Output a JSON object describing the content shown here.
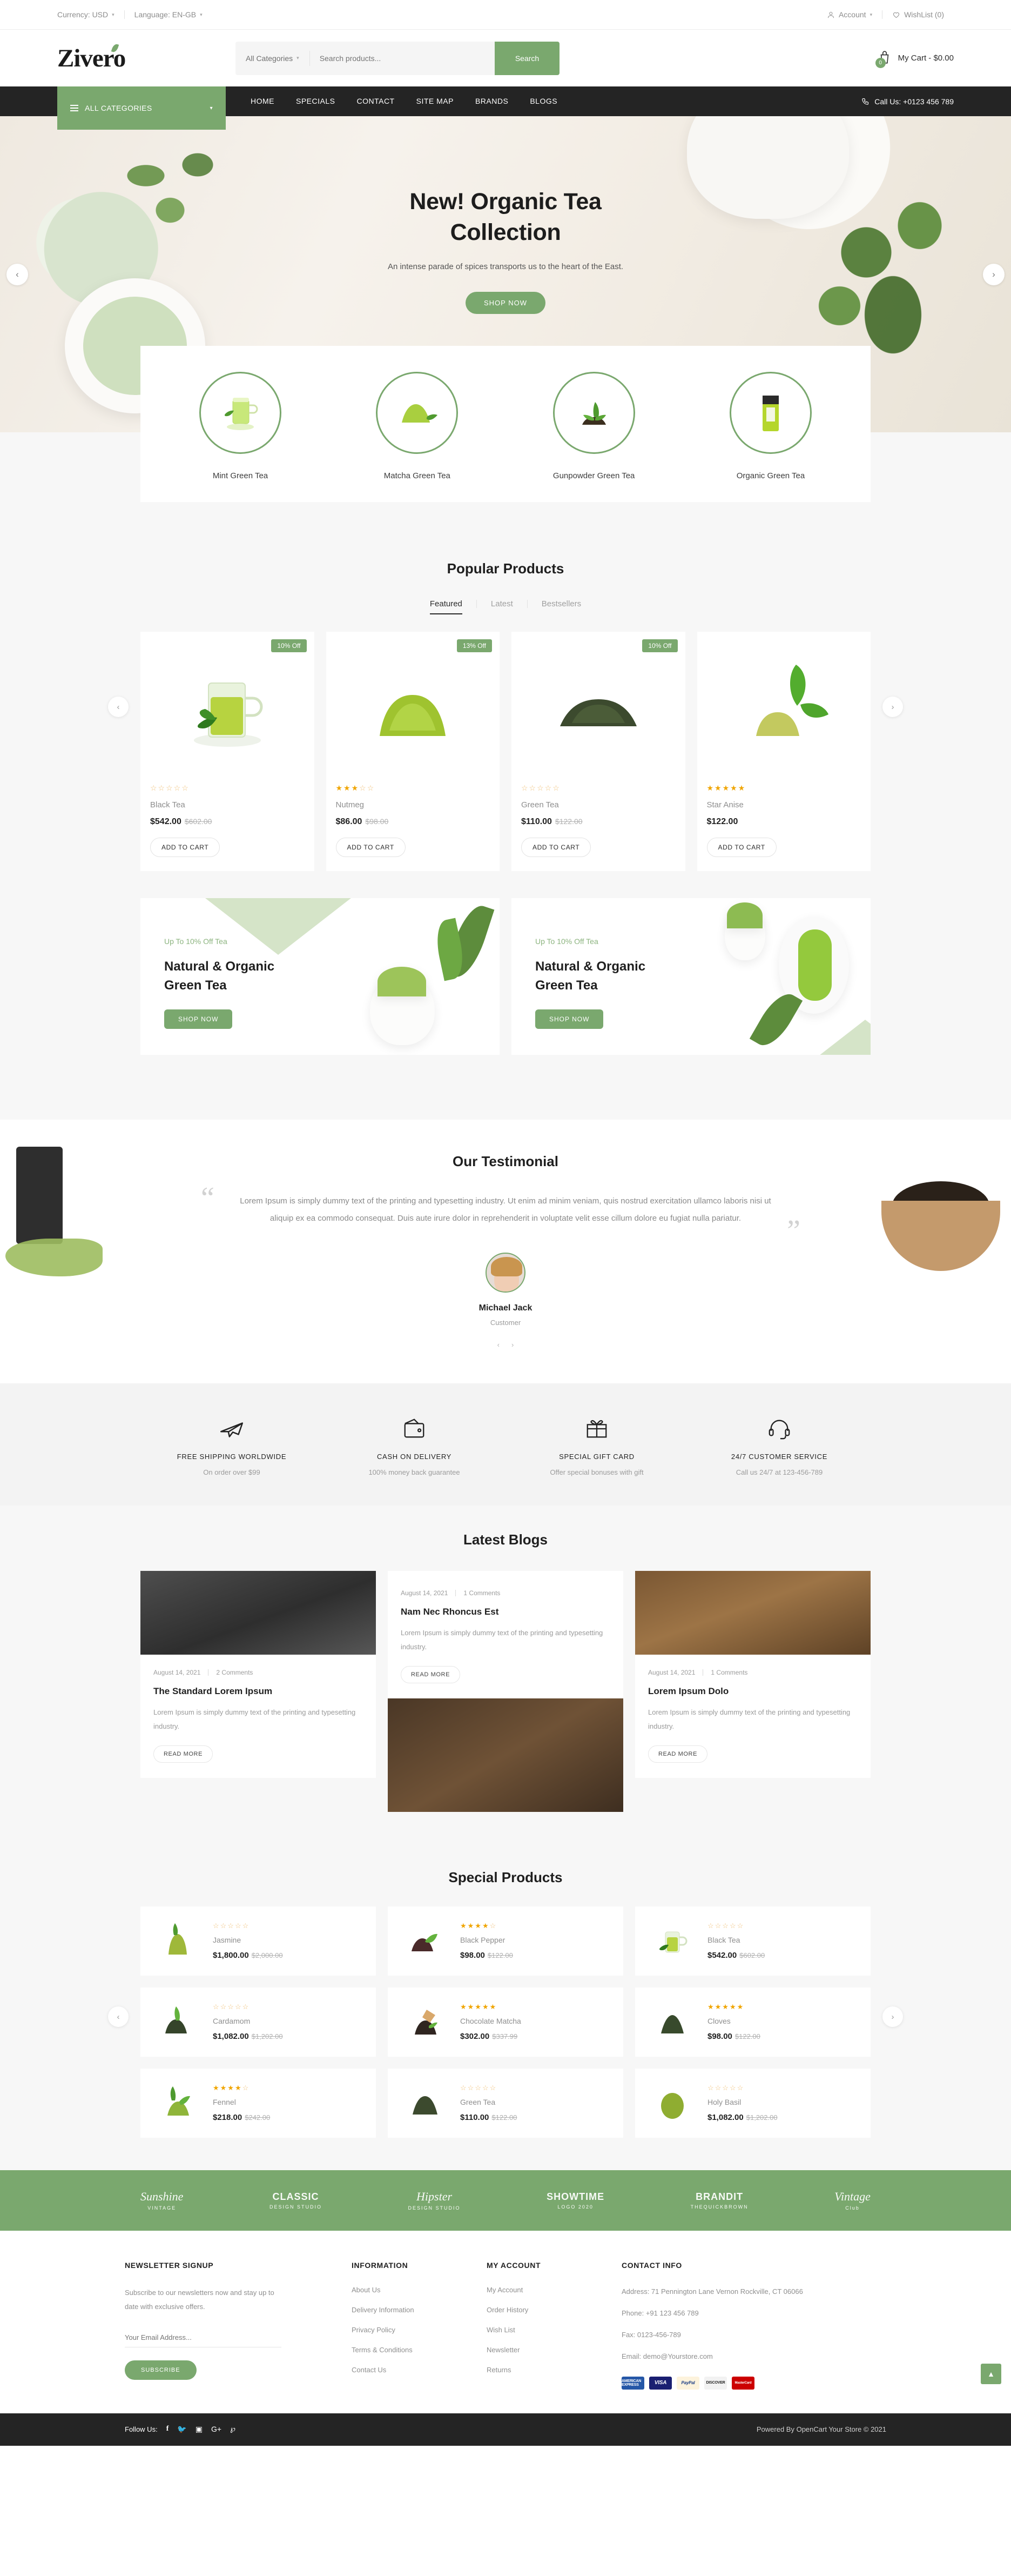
{
  "topbar": {
    "currency_label": "Currency: USD",
    "language_label": "Language: EN-GB",
    "account_label": "Account",
    "wishlist_label": "WishList (0)"
  },
  "header": {
    "logo": "Zivero",
    "category_select": "All Categories",
    "search_placeholder": "Search products...",
    "search_button": "Search",
    "cart_label": "My Cart - $0.00",
    "cart_count": "0"
  },
  "nav": {
    "all_categories": "ALL CATEGORIES",
    "links": [
      "HOME",
      "SPECIALS",
      "CONTACT",
      "SITE MAP",
      "BRANDS",
      "BLOGS"
    ],
    "call_us": "Call Us: +0123 456 789"
  },
  "hero": {
    "title_line1": "New! Organic Tea",
    "title_line2": "Collection",
    "subtitle": "An intense parade of spices transports us to the heart of the East.",
    "cta": "SHOP NOW",
    "prev": "‹",
    "next": "›"
  },
  "categories": [
    {
      "name": "Mint Green Tea"
    },
    {
      "name": "Matcha Green Tea"
    },
    {
      "name": "Gunpowder Green Tea"
    },
    {
      "name": "Organic Green Tea"
    }
  ],
  "popular": {
    "title": "Popular Products",
    "tabs": [
      {
        "label": "Featured",
        "active": true
      },
      {
        "label": "Latest",
        "active": false
      },
      {
        "label": "Bestsellers",
        "active": false
      }
    ],
    "add_to_cart": "ADD TO CART",
    "prev": "‹",
    "next": "›",
    "products": [
      {
        "name": "Black Tea",
        "price": "$542.00",
        "old_price": "$602.00",
        "badge": "10% Off",
        "stars": 0
      },
      {
        "name": "Nutmeg",
        "price": "$86.00",
        "old_price": "$98.00",
        "badge": "13% Off",
        "stars": 3
      },
      {
        "name": "Green Tea",
        "price": "$110.00",
        "old_price": "$122.00",
        "badge": "10% Off",
        "stars": 0
      },
      {
        "name": "Star Anise",
        "price": "$122.00",
        "old_price": "",
        "badge": "",
        "stars": 5
      }
    ]
  },
  "promos": [
    {
      "kicker": "Up To 10% Off Tea",
      "heading_1": "Natural & Organic",
      "heading_2": "Green Tea",
      "cta": "SHOP NOW"
    },
    {
      "kicker": "Up To 10% Off Tea",
      "heading_1": "Natural & Organic",
      "heading_2": "Green Tea",
      "cta": "SHOP NOW"
    }
  ],
  "testimonial": {
    "title": "Our Testimonial",
    "quote": "Lorem Ipsum is simply dummy text of the printing and typesetting industry. Ut enim ad minim veniam, quis nostrud exercitation ullamco laboris nisi ut aliquip ex ea commodo consequat. Duis aute irure dolor in reprehenderit in voluptate velit esse cillum dolore eu fugiat nulla pariatur.",
    "name": "Michael Jack",
    "role": "Customer",
    "quote_open": "“",
    "quote_close": "”",
    "prev": "‹",
    "next": "›"
  },
  "services": [
    {
      "icon": "airplane-icon",
      "title": "FREE SHIPPING WORLDWIDE",
      "sub": "On order over $99"
    },
    {
      "icon": "wallet-icon",
      "title": "CASH ON DELIVERY",
      "sub": "100% money back guarantee"
    },
    {
      "icon": "gift-icon",
      "title": "SPECIAL GIFT CARD",
      "sub": "Offer special bonuses with gift"
    },
    {
      "icon": "headset-icon",
      "title": "24/7 CUSTOMER SERVICE",
      "sub": "Call us 24/7 at 123-456-789"
    }
  ],
  "blogs": {
    "title": "Latest Blogs",
    "read_more": "READ MORE",
    "posts": [
      {
        "date": "August 14, 2021",
        "comments": "2 Comments",
        "title": "The Standard Lorem Ipsum",
        "excerpt": "Lorem Ipsum is simply dummy text of the printing and typesetting industry."
      },
      {
        "date": "August 14, 2021",
        "comments": "1 Comments",
        "title": "Nam Nec Rhoncus Est",
        "excerpt": "Lorem Ipsum is simply dummy text of the printing and typesetting industry."
      },
      {
        "date": "August 14, 2021",
        "comments": "1 Comments",
        "title": "Lorem Ipsum Dolo",
        "excerpt": "Lorem Ipsum is simply dummy text of the printing and typesetting industry."
      }
    ]
  },
  "special": {
    "title": "Special Products",
    "prev": "‹",
    "next": "›",
    "products": [
      {
        "name": "Jasmine",
        "price": "$1,800.00",
        "old_price": "$2,000.00",
        "stars": 0
      },
      {
        "name": "Black Pepper",
        "price": "$98.00",
        "old_price": "$122.00",
        "stars": 4
      },
      {
        "name": "Black Tea",
        "price": "$542.00",
        "old_price": "$602.00",
        "stars": 0
      },
      {
        "name": "Cardamom",
        "price": "$1,082.00",
        "old_price": "$1,202.00",
        "stars": 0
      },
      {
        "name": "Chocolate Matcha",
        "price": "$302.00",
        "old_price": "$337.99",
        "stars": 5
      },
      {
        "name": "Cloves",
        "price": "$98.00",
        "old_price": "$122.00",
        "stars": 5
      },
      {
        "name": "Fennel",
        "price": "$218.00",
        "old_price": "$242.00",
        "stars": 4
      },
      {
        "name": "Green Tea",
        "price": "$110.00",
        "old_price": "$122.00",
        "stars": 0
      },
      {
        "name": "Holy Basil",
        "price": "$1,082.00",
        "old_price": "$1,202.00",
        "stars": 0
      }
    ]
  },
  "brands": [
    {
      "name": "Sunshine",
      "sub": "VINTAGE"
    },
    {
      "name": "CLASSIC",
      "sub": "DESIGN STUDIO"
    },
    {
      "name": "Hipster",
      "sub": "DESIGN STUDIO"
    },
    {
      "name": "SHOWTIME",
      "sub": "LOGO 2020"
    },
    {
      "name": "BRANDIT",
      "sub": "THEQUICKBROWN"
    },
    {
      "name": "Vintage",
      "sub": "Club"
    }
  ],
  "footer": {
    "newsletter": {
      "heading": "NEWSLETTER SIGNUP",
      "text": "Subscribe to our newsletters now and stay up to date with exclusive offers.",
      "placeholder": "Your Email Address...",
      "button": "SUBSCRIBE"
    },
    "information": {
      "heading": "INFORMATION",
      "links": [
        "About Us",
        "Delivery Information",
        "Privacy Policy",
        "Terms & Conditions",
        "Contact Us"
      ]
    },
    "account": {
      "heading": "MY ACCOUNT",
      "links": [
        "My Account",
        "Order History",
        "Wish List",
        "Newsletter",
        "Returns"
      ]
    },
    "contact": {
      "heading": "CONTACT INFO",
      "address": "Address: 71 Pennington Lane Vernon Rockville, CT 06066",
      "phone": "Phone: +91 123 456 789",
      "fax": "Fax: 0123-456-789",
      "email": "Email: demo@Yourstore.com",
      "cards": [
        "AMERICAN EXPRESS",
        "VISA",
        "PayPal",
        "DISCOVER",
        "MasterCard"
      ]
    }
  },
  "bottom": {
    "follow_label": "Follow Us:",
    "socials": [
      "facebook-icon",
      "twitter-icon",
      "instagram-icon",
      "google-plus-icon",
      "pinterest-icon"
    ],
    "copyright": "Powered By OpenCart Your Store © 2021",
    "to_top": "▲"
  },
  "colors": {
    "accent": "#7aa86e",
    "dark": "#242424",
    "star": "#f0a500",
    "page_bg": "#f7f7f7"
  }
}
